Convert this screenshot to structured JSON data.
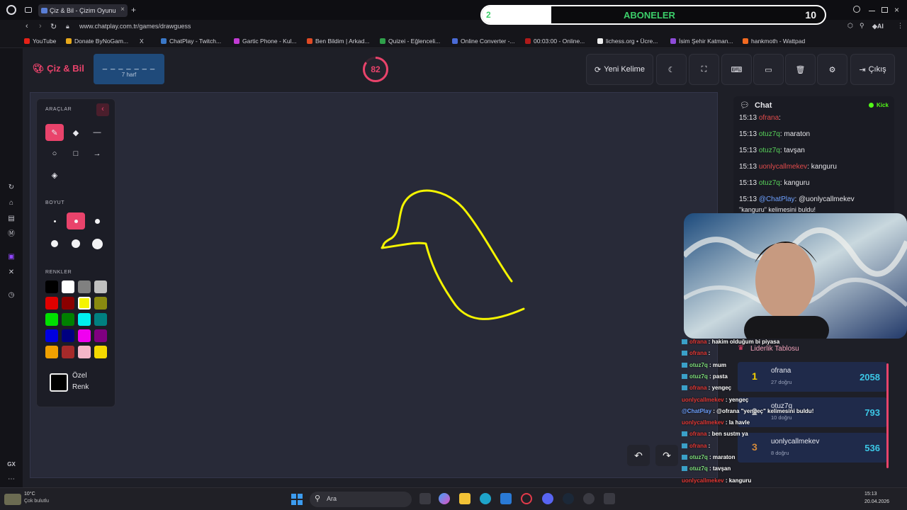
{
  "browser": {
    "tab_title": "Çiz & Bil - Çizim Oyunu",
    "url": "www.chatplay.com.tr/games/drawguess",
    "bookmarks": [
      "YouTube",
      "Donate ByNoGam...",
      "X",
      "ChatPlay - Twitch...",
      "Gartic Phone - Kul...",
      "Ben Bildim | Arkad...",
      "Quizei - Eğlenceli...",
      "Online Converter -...",
      "00:03:00 - Online...",
      "lichess.org • Ücre...",
      "İsim Şehir Katman...",
      "hankmoth - Wattpad"
    ],
    "gx_label": "GX"
  },
  "subscribers": {
    "label": "ABONELER",
    "current": "2",
    "goal": "10",
    "progress": 0.2
  },
  "header": {
    "logo": "Çiz & Bil",
    "word_mask": "_ _ _ _ _ _ _",
    "word_hint": "7 harf",
    "timer": "82",
    "timer_fraction": 0.85,
    "new_word": "Yeni Kelime",
    "exit": "Çıkış"
  },
  "tools": {
    "title": "ARAÇLAR",
    "size_title": "BOYUT",
    "colors_title": "RENKLER",
    "custom_line1": "Özel",
    "custom_line2": "Renk",
    "palette": [
      "#000000",
      "#ffffff",
      "#808080",
      "#c0c0c0",
      "#e00000",
      "#8b0000",
      "#f4f400",
      "#8a8a10",
      "#00e000",
      "#008000",
      "#00f0f0",
      "#008080",
      "#0000e0",
      "#000080",
      "#f000f0",
      "#800080",
      "#f0a000",
      "#a52a2a",
      "#f4b6c8",
      "#f4d800"
    ],
    "selected_color": "#f4f400"
  },
  "chat": {
    "title": "Chat",
    "source": "Kick",
    "messages": [
      {
        "time": "15:13",
        "user": "ofrana",
        "text": "",
        "color": "red"
      },
      {
        "time": "15:13",
        "user": "otuz7q",
        "text": "maraton",
        "color": "green"
      },
      {
        "time": "15:13",
        "user": "otuz7q",
        "text": "tavşan",
        "color": "green"
      },
      {
        "time": "15:13",
        "user": "uonlycallmekev",
        "text": "kanguru",
        "color": "red"
      },
      {
        "time": "15:13",
        "user": "otuz7q",
        "text": "kanguru",
        "color": "green"
      },
      {
        "time": "15:13",
        "user": "@ChatPlay",
        "text": "@uonlycallmekev",
        "color": "blue"
      }
    ],
    "last_line2": "\"kanguru\" kelimesini buldu!"
  },
  "leaderboard": {
    "title": "Liderlik Tablosu",
    "rows": [
      {
        "rank": "1",
        "name": "ofrana",
        "sub": "27 doğru",
        "score": "2058"
      },
      {
        "rank": "2",
        "name": "otuz7q",
        "sub": "10 doğru",
        "score": "793"
      },
      {
        "rank": "3",
        "name": "uonlycallmekev",
        "sub": "8 doğru",
        "score": "536"
      }
    ]
  },
  "overlay_chat": [
    {
      "user": "ofrana",
      "text": "hakim olduğum bi piyasa",
      "c": "r"
    },
    {
      "user": "ofrana",
      "text": "",
      "c": "r"
    },
    {
      "user": "otuz7q",
      "text": "mum",
      "c": "n"
    },
    {
      "user": "otuz7q",
      "text": "pasta",
      "c": "n"
    },
    {
      "user": "ofrana",
      "text": "yengeç",
      "c": "r"
    },
    {
      "user": "uonlycallmekev",
      "text": "yengeç",
      "c": "r"
    },
    {
      "user": "@ChatPlay",
      "text": "@ofrana \"yengeç\" kelimesini buldu!",
      "c": "m"
    },
    {
      "user": "uonlycallmekev",
      "text": "la havle",
      "c": "r"
    },
    {
      "user": "ofrana",
      "text": "ben sustm ya",
      "c": "r"
    },
    {
      "user": "ofrana",
      "text": "",
      "c": "r"
    },
    {
      "user": "otuz7q",
      "text": "maraton",
      "c": "n"
    },
    {
      "user": "otuz7q",
      "text": "tavşan",
      "c": "n"
    },
    {
      "user": "uonlycallmekev",
      "text": "kanguru",
      "c": "r"
    },
    {
      "user": "otuz7q",
      "text": "kanguru",
      "c": "n"
    },
    {
      "user": "@ChatPlay",
      "text": "@uonlycallmekev \"kanguru\" kelimesini buldu!",
      "c": "m"
    }
  ],
  "taskbar": {
    "search": "Ara",
    "weather_temp": "10°C",
    "weather_desc": "Çok bulutlu",
    "time": "15:13",
    "date": "20.04.2026"
  }
}
